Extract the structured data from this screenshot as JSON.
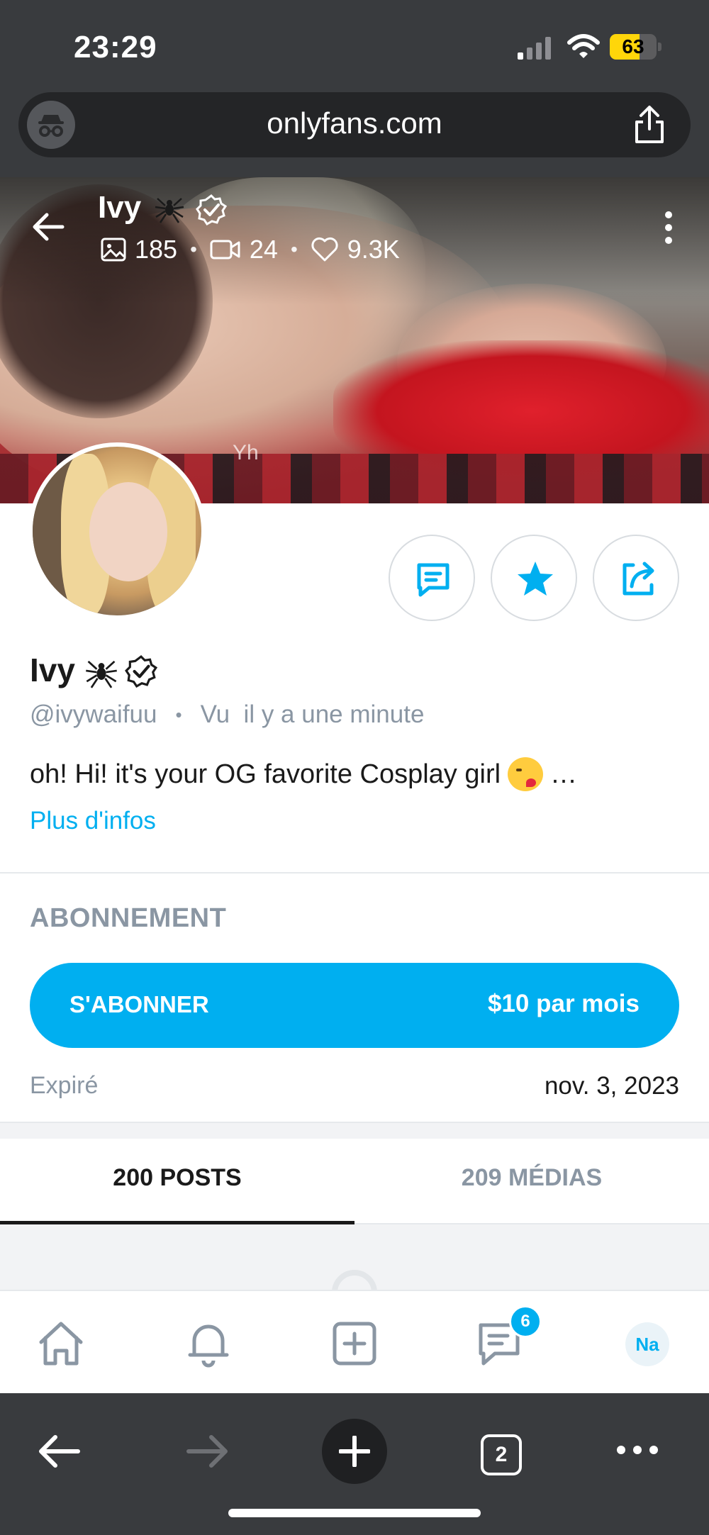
{
  "status_bar": {
    "time": "23:29",
    "battery": "63",
    "battery_level": 0.63
  },
  "browser": {
    "url": "onlyfans.com",
    "tab_count": "2"
  },
  "cover": {
    "watermark": "Yh"
  },
  "header": {
    "name": "Ivy",
    "photos": "185",
    "videos": "24",
    "likes": "9.3K"
  },
  "profile": {
    "name": "Ivy",
    "handle": "@ivywaifuu",
    "last_seen": "Vu  il y a une minute",
    "bio": "oh! Hi! it's your OG favorite Cosplay girl",
    "bio_ellipsis": "…",
    "more_info": "Plus d'infos"
  },
  "subscription": {
    "title": "ABONNEMENT",
    "button_label": "S'ABONNER",
    "price": "$10 par mois",
    "expired_label": "Expiré",
    "expired_date": "nov. 3, 2023"
  },
  "tabs": [
    {
      "label": "200 POSTS",
      "active": true
    },
    {
      "label": "209 MÉDIAS",
      "active": false
    }
  ],
  "bottom_nav": {
    "messages_badge": "6",
    "user_initials": "Na"
  },
  "icons": {
    "incognito": "incognito-icon",
    "share": "share-icon",
    "back": "back-arrow-icon",
    "spider": "spider-emoji",
    "verified": "verified-icon",
    "photo": "photo-icon",
    "video": "video-icon",
    "heart": "heart-icon",
    "more": "kebab-icon",
    "message": "message-icon",
    "star": "star-icon",
    "emoji": "kiss-emoji",
    "home": "home-icon",
    "bell": "bell-icon",
    "add": "add-square-icon",
    "chat": "chat-icon"
  },
  "colors": {
    "accent": "#00aff0",
    "muted": "#8a96a3",
    "chrome": "#393b3e",
    "battery": "#ffd60a"
  }
}
